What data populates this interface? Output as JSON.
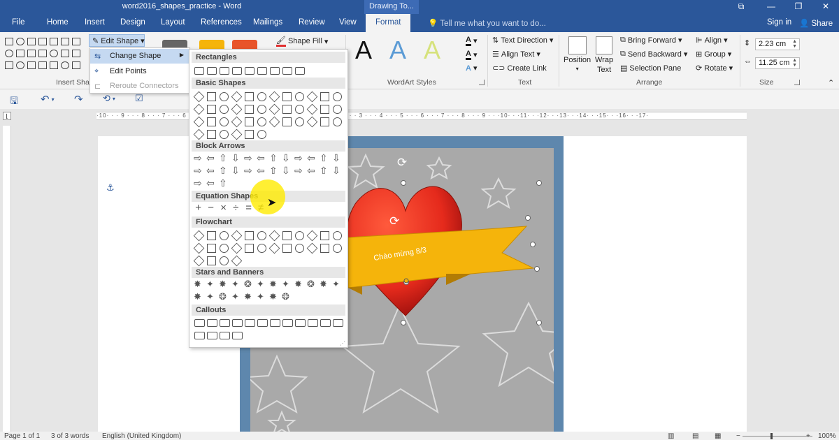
{
  "window": {
    "title": "word2016_shapes_practice - Word",
    "context_tab": "Drawing To...",
    "controls": {
      "restore": "⧉",
      "minimize": "—",
      "maximize": "❐",
      "close": "✕"
    }
  },
  "tabs": [
    "File",
    "Home",
    "Insert",
    "Design",
    "Layout",
    "References",
    "Mailings",
    "Review",
    "View",
    "Format"
  ],
  "active_tab": "Format",
  "tell_me": "Tell me what you want to do...",
  "account": {
    "sign_in": "Sign in",
    "share": "Share"
  },
  "ribbon": {
    "insert_shapes": {
      "label": "Insert Shap",
      "edit_shape": "Edit Shape"
    },
    "shape_fill": "Shape Fill",
    "wordart_styles": {
      "label": "WordArt Styles",
      "letter": "A"
    },
    "text": {
      "label": "Text",
      "text_direction": "Text Direction",
      "align_text": "Align Text",
      "create_link": "Create Link"
    },
    "arrange": {
      "label": "Arrange",
      "position": "Position",
      "wrap_text_1": "Wrap",
      "wrap_text_2": "Text",
      "bring_forward": "Bring Forward",
      "send_backward": "Send Backward",
      "selection_pane": "Selection Pane",
      "align": "Align",
      "group": "Group",
      "rotate": "Rotate"
    },
    "size": {
      "label": "Size",
      "height": "2.23 cm",
      "width": "11.25 cm"
    }
  },
  "edit_menu": {
    "change_shape": "Change Shape",
    "edit_points": "Edit Points",
    "reroute_connectors": "Reroute Connectors"
  },
  "shape_panel": {
    "sections": [
      "Rectangles",
      "Basic Shapes",
      "Block Arrows",
      "Equation Shapes",
      "Flowchart",
      "Stars and Banners",
      "Callouts"
    ]
  },
  "ruler": {
    "text": "·10· · · 9 · · · 8 · · · 7 · · · 6 · · · 5 · · · 4 · · · 3 · · · 2 · · · 1 · · ·△· · 1 · · · 2 · · · 3 · · · 4 · · · 5 · · · 6 · · · 7 · · · 8 · · · 9 · · ·10· · ·11· · ·12· · ·13· · ·14· · ·15· · ·16· · ·17·"
  },
  "document": {
    "banner_text": "Chào mừng 8/3"
  },
  "status": {
    "page": "Page 1 of 1",
    "words": "3 of 3 words",
    "language": "English (United Kingdom)",
    "zoom": "100%"
  },
  "colors": {
    "title_bar": "#2b579a",
    "heart": "#e52a1c",
    "banner": "#f5b40b",
    "card_border": "#5e87ad",
    "card_bg": "#a9a9a9"
  }
}
